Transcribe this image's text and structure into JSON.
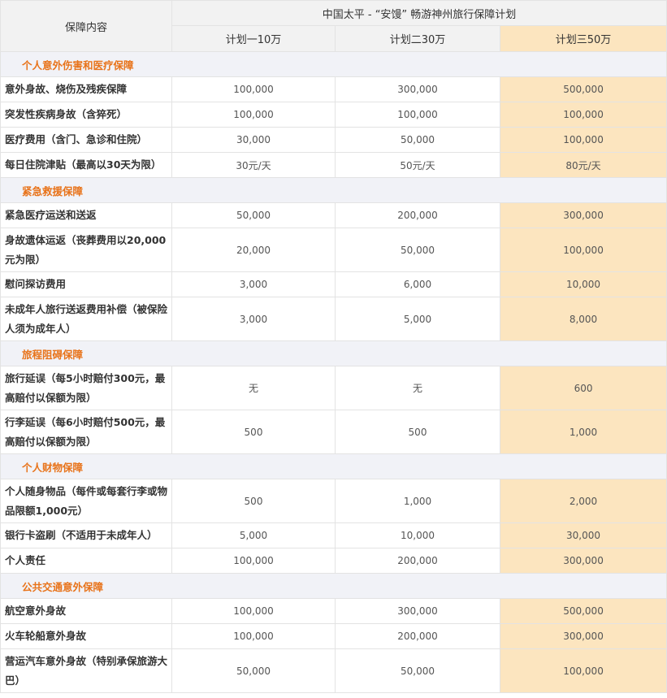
{
  "header": {
    "item_col": "保障内容",
    "title": "中国太平 - “安馒” 畅游神州旅行保障计划",
    "plans": [
      "计划一10万",
      "计划二30万",
      "计划三50万"
    ]
  },
  "sections": [
    {
      "title": "个人意外伤害和医疗保障",
      "rows": [
        {
          "item": "意外身故、烧伤及残疾保障",
          "values": [
            "100,000",
            "300,000",
            "500,000"
          ]
        },
        {
          "item": "突发性疾病身故（含猝死）",
          "values": [
            "100,000",
            "100,000",
            "100,000"
          ]
        },
        {
          "item": "医疗费用（含门、急诊和住院）",
          "values": [
            "30,000",
            "50,000",
            "100,000"
          ]
        },
        {
          "item": "每日住院津贴（最高以30天为限）",
          "values": [
            "30元/天",
            "50元/天",
            "80元/天"
          ]
        }
      ]
    },
    {
      "title": "紧急救援保障",
      "rows": [
        {
          "item": "紧急医疗运送和送返",
          "values": [
            "50,000",
            "200,000",
            "300,000"
          ]
        },
        {
          "item": "身故遗体运返（丧葬费用以20,000元为限）",
          "values": [
            "20,000",
            "50,000",
            "100,000"
          ]
        },
        {
          "item": "慰问探访费用",
          "values": [
            "3,000",
            "6,000",
            "10,000"
          ]
        },
        {
          "item": "未成年人旅行送返费用补偿（被保险人须为成年人）",
          "values": [
            "3,000",
            "5,000",
            "8,000"
          ]
        }
      ]
    },
    {
      "title": "旅程阻碍保障",
      "rows": [
        {
          "item": "旅行延误（每5小时赔付300元，最高赔付以保额为限）",
          "values": [
            "无",
            "无",
            "600"
          ]
        },
        {
          "item": "行李延误（每6小时赔付500元，最高赔付以保额为限）",
          "values": [
            "500",
            "500",
            "1,000"
          ]
        }
      ]
    },
    {
      "title": "个人财物保障",
      "rows": [
        {
          "item": "个人随身物品（每件或每套行李或物品限额1,000元）",
          "values": [
            "500",
            "1,000",
            "2,000"
          ]
        },
        {
          "item": "银行卡盗刷（不适用于未成年人）",
          "values": [
            "5,000",
            "10,000",
            "30,000"
          ]
        },
        {
          "item": "个人责任",
          "values": [
            "100,000",
            "200,000",
            "300,000"
          ]
        }
      ]
    },
    {
      "title": "公共交通意外保障",
      "rows": [
        {
          "item": "航空意外身故",
          "values": [
            "100,000",
            "300,000",
            "500,000"
          ]
        },
        {
          "item": "火车轮船意外身故",
          "values": [
            "100,000",
            "200,000",
            "300,000"
          ]
        },
        {
          "item": "营运汽车意外身故（特别承保旅游大巴）",
          "values": [
            "50,000",
            "50,000",
            "100,000"
          ]
        }
      ]
    }
  ],
  "tall_rows": [
    "身故遗体运返（丧葬费用以20,000元为限）",
    "未成年人旅行送返费用补偿（被保险人须为成年人）",
    "旅行延误（每5小时赔付300元，最高赔付以保额为限）",
    "行李延误（每6小时赔付500元，最高赔付以保额为限）",
    "个人随身物品（每件或每套行李或物品限额1,000元）",
    "营运汽车意外身故（特别承保旅游大巴）"
  ],
  "colors": {
    "section_title": "#e8731a",
    "highlight_plan": "#fce5bf",
    "header_bg": "#f2f2f2",
    "section_bg": "#f1f2f7"
  }
}
